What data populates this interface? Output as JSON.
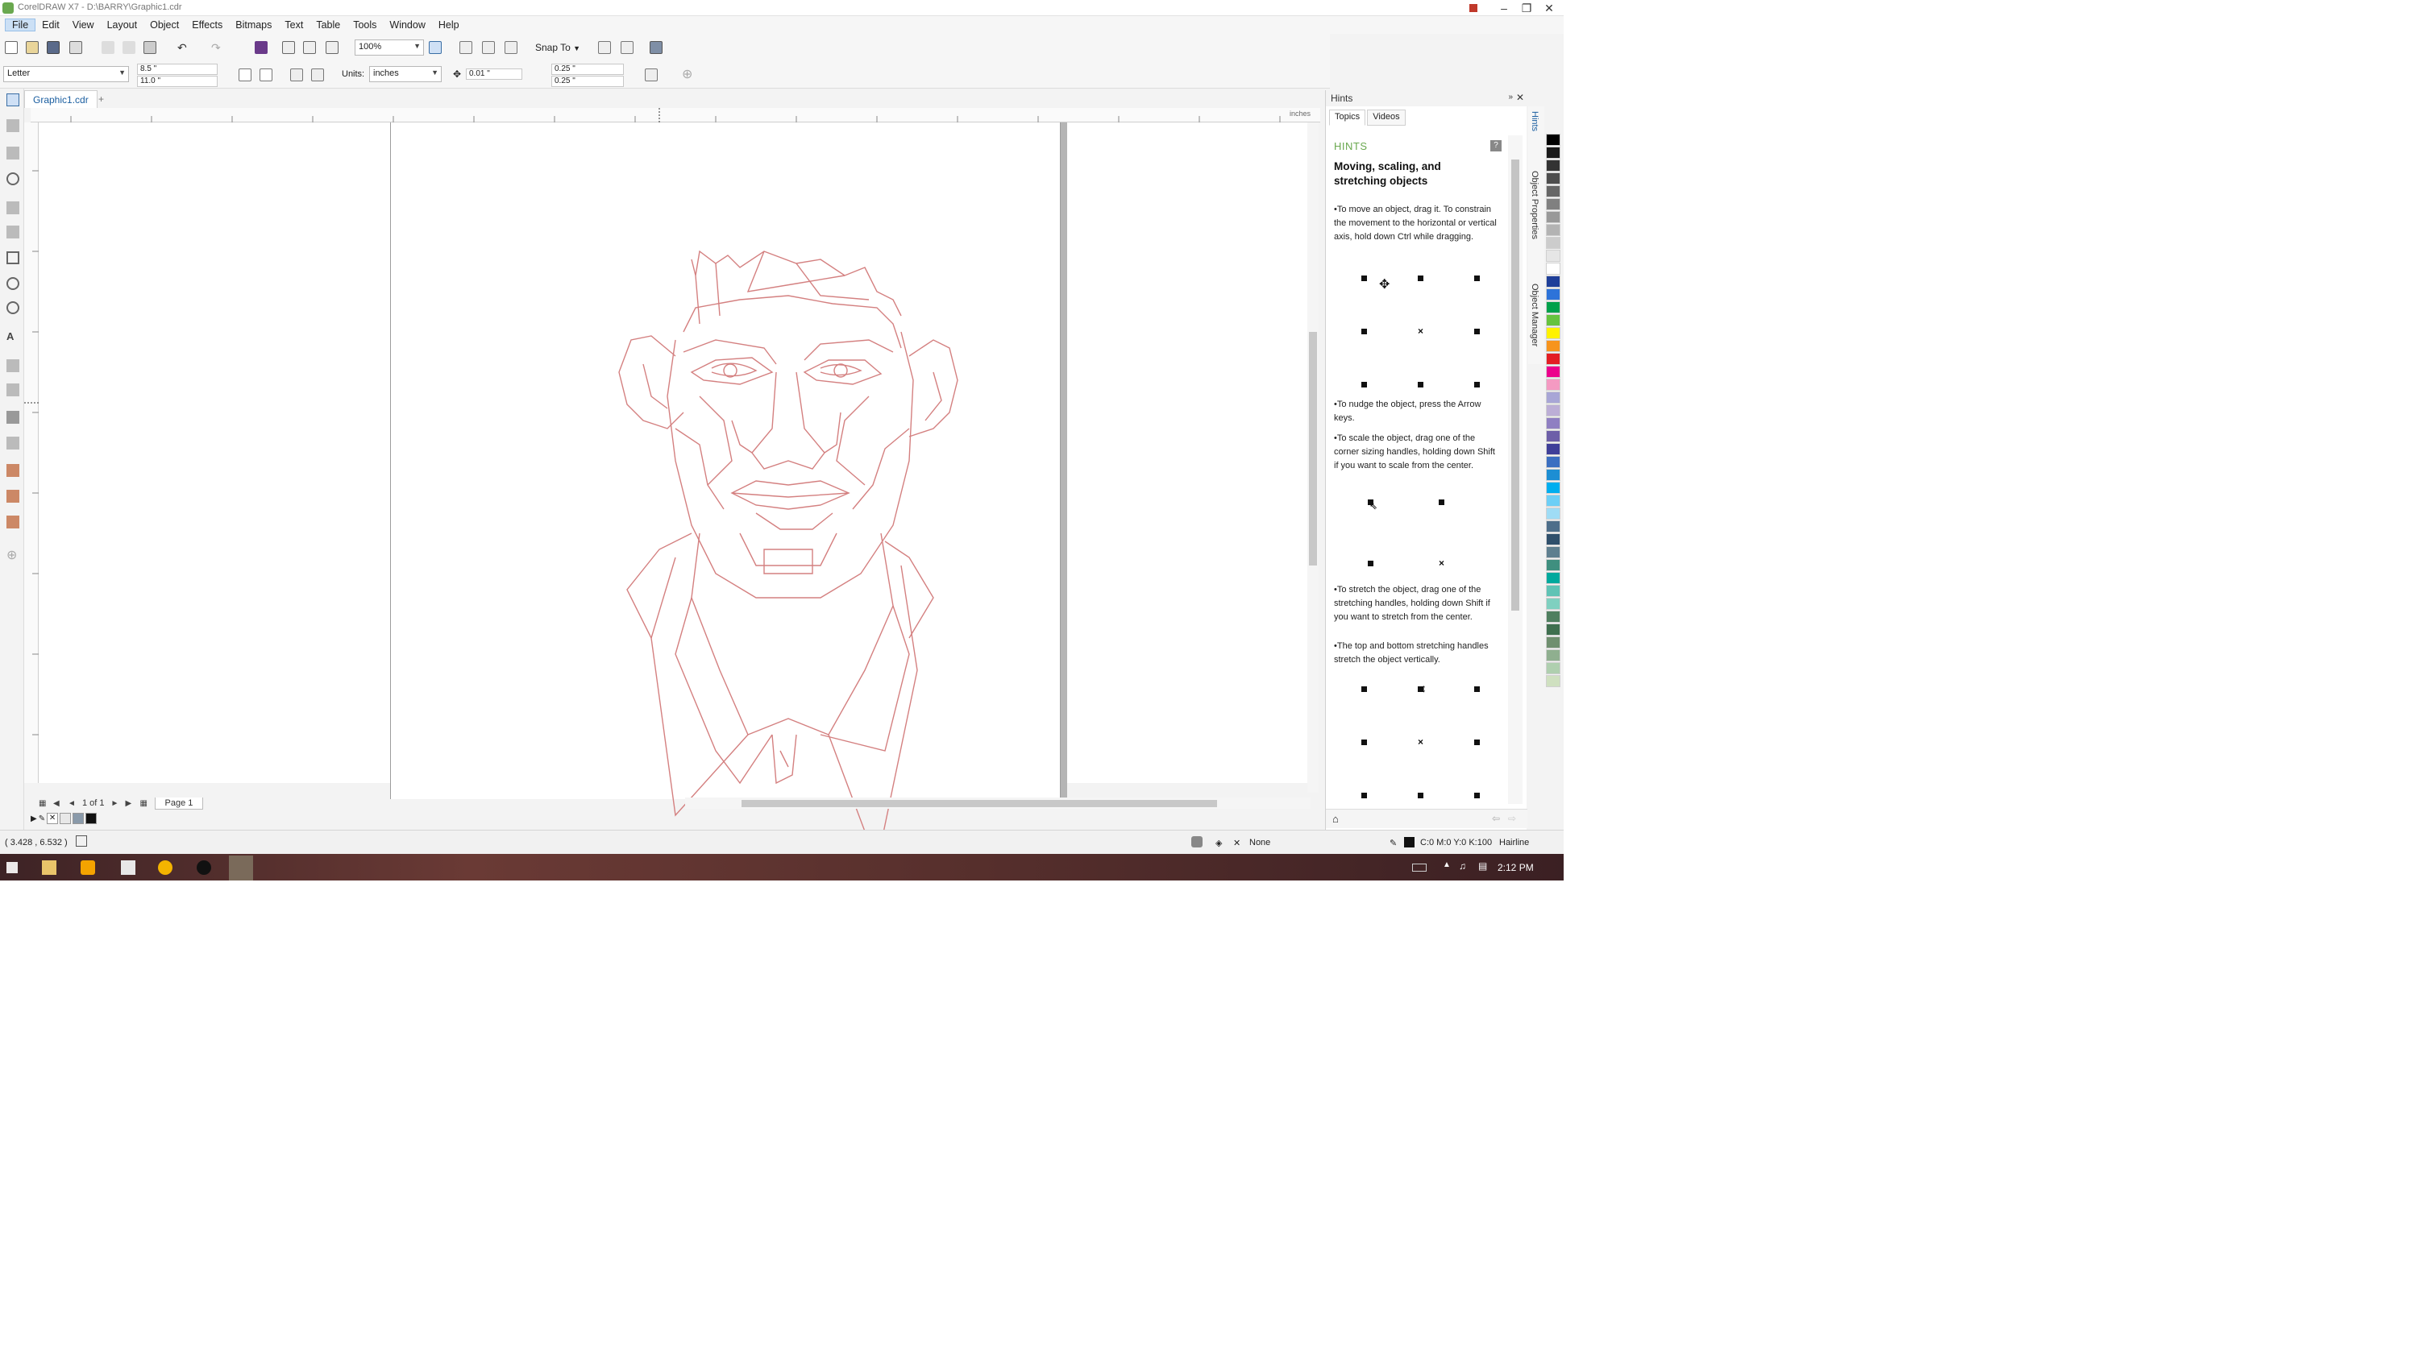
{
  "window": {
    "title": "CorelDRAW X7 - D:\\BARRY\\Graphic1.cdr"
  },
  "menu": [
    "File",
    "Edit",
    "View",
    "Layout",
    "Object",
    "Effects",
    "Bitmaps",
    "Text",
    "Table",
    "Tools",
    "Window",
    "Help"
  ],
  "standard_toolbar": {
    "zoom": "100%",
    "snap_to": "Snap To"
  },
  "property_bar": {
    "page_size": "Letter",
    "width": "8.5 \"",
    "height": "11.0 \"",
    "units_label": "Units:",
    "units": "inches",
    "nudge": "0.01 \"",
    "dup_x": "0.25 \"",
    "dup_y": "0.25 \""
  },
  "document": {
    "tab_label": "Graphic1.cdr",
    "ruler_unit": "inches",
    "page_counter": "1 of 1",
    "page_tab": "Page 1"
  },
  "hints": {
    "docker_title": "Hints",
    "tabs": [
      "Topics",
      "Videos"
    ],
    "header": "HINTS",
    "help_glyph": "?",
    "title": "Moving, scaling, and stretching objects",
    "p1": "•To move an object, drag it. To constrain the movement to the horizontal or vertical axis, hold down Ctrl while dragging.",
    "p2": "•To nudge the object, press the Arrow keys.",
    "p3": "•To scale the object, drag one of the corner sizing handles, holding down Shift if you want to scale from the center.",
    "p4": "•To stretch the object, drag one of the stretching handles, holding down Shift if you want to stretch from the center.",
    "p5": "•The top and bottom stretching handles stretch the object vertically."
  },
  "side_tabs": [
    "Hints",
    "Object Properties",
    "Object Manager"
  ],
  "statusbar": {
    "coords": "( 3.428 , 6.532 )",
    "fill": "None",
    "outline_color": "C:0 M:0 Y:0 K:100",
    "outline_width": "Hairline"
  },
  "taskbar": {
    "time": "2:12 PM"
  },
  "colors": {
    "accent": "#6aa84f",
    "drawing_stroke": "#d48080",
    "palette": [
      "#000000",
      "#1a1a1a",
      "#333333",
      "#4d4d4d",
      "#666666",
      "#808080",
      "#999999",
      "#b3b3b3",
      "#cccccc",
      "#e6e6e6",
      "#ffffff",
      "#1f3f99",
      "#2d73d9",
      "#00a14b",
      "#66c33f",
      "#fff200",
      "#f7941d",
      "#e31e24",
      "#ec008c",
      "#f49ac2",
      "#a8a6d6",
      "#bcaed6",
      "#8f7fc2",
      "#6d5fa8",
      "#3f3f99",
      "#3b6fc1",
      "#1d8ed3",
      "#00aeef",
      "#6dcff6",
      "#9fdcf5",
      "#4d6e8a",
      "#2f4f6b",
      "#5f7f8f",
      "#3f8f7f",
      "#00a99d",
      "#5fc3b5",
      "#7fd0c0",
      "#4f7f5f",
      "#3f6f4f",
      "#6f8f6f",
      "#8faf8f",
      "#afcfaf",
      "#cfe0c0"
    ]
  }
}
